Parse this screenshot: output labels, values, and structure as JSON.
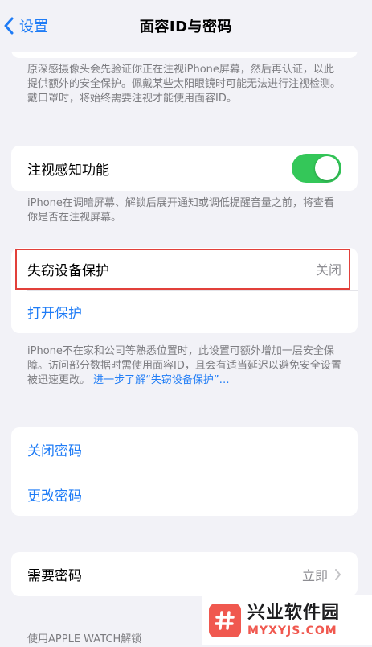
{
  "nav": {
    "back_label": "设置",
    "title": "面容ID与密码"
  },
  "attention_footer": "原深感摄像头会先验证你正在注视iPhone屏幕，然后再认证，以此提供额外的安全保护。佩戴某些太阳眼镜时可能无法进行注视检测。戴口罩时，将始终需要注视才能使用面容ID。",
  "attention_aware": {
    "label": "注视感知功能",
    "enabled": true,
    "footer": "iPhone在调暗屏幕、解锁后展开通知或调低提醒音量之前，将查看你是否在注视屏幕。"
  },
  "stolen_device": {
    "label": "失窃设备保护",
    "value": "关闭",
    "action": "打开保护",
    "footer": "iPhone不在家和公司等熟悉位置时，此设置可额外增加一层安全保障。访问部分数据时需使用面容ID，且会有适当延迟以避免安全设置被迅速更改。",
    "footer_link": "进一步了解“失窃设备保护”…"
  },
  "passcode": {
    "turn_off": "关闭密码",
    "change": "更改密码"
  },
  "require_passcode": {
    "label": "需要密码",
    "value": "立即"
  },
  "watch_section_header": "使用APPLE WATCH解锁",
  "watermark": {
    "name": "兴业软件园",
    "url": "MYXYJS.COM"
  },
  "colors": {
    "accent": "#1f7cf6",
    "toggle_on": "#34c759",
    "highlight": "#e2403a",
    "watermark": "#f0584f"
  }
}
